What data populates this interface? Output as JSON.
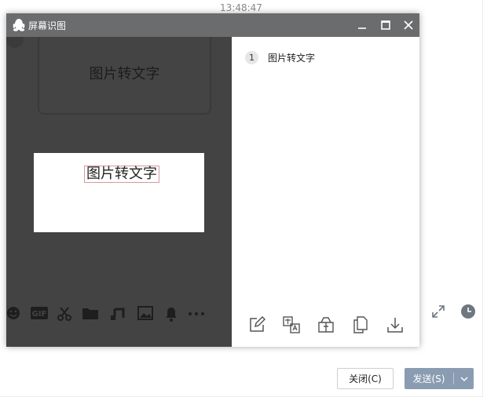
{
  "chat": {
    "timestamp": "13:48:47",
    "close_label": "关闭(C)",
    "send_label": "发送(S)",
    "icons": [
      "fullscreen-icon",
      "history-clock-icon"
    ]
  },
  "ocr_window": {
    "title": "屏幕识图",
    "controls": [
      "minimize-icon",
      "maximize-icon",
      "close-icon"
    ],
    "preview_behind_text": "图片转文字",
    "preview_text": "图片转文字",
    "results": [
      {
        "index": "1",
        "text": "图片转文字"
      }
    ],
    "actions": [
      "edit-icon",
      "translate-icon",
      "share-icon",
      "copy-icon",
      "download-icon"
    ]
  },
  "chat_toolbar": {
    "icons": [
      "emoji-icon",
      "gif-icon",
      "scissors-icon",
      "folder-icon",
      "music-icon",
      "image-icon",
      "bell-icon",
      "more-icon"
    ],
    "gif_label": "GIF"
  },
  "colors": {
    "titlebar": "#6a6c6e",
    "left_pane": "#434343",
    "send_button": "#8a9cb1"
  }
}
